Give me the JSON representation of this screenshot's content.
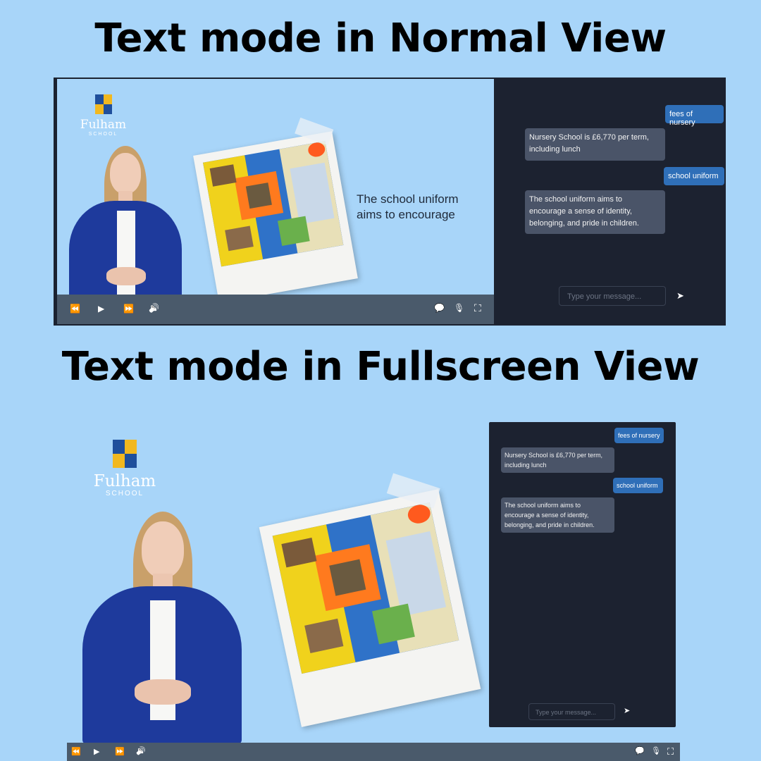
{
  "headings": {
    "normal": "Text mode in Normal View",
    "fullscreen": "Text mode in Fullscreen View"
  },
  "logo": {
    "name": "Fulham",
    "sub": "SCHOOL"
  },
  "slide": {
    "caption_line1": "The school uniform",
    "caption_line2": "aims to encourage"
  },
  "controls": {
    "rewind_icon": "⏪",
    "play_icon": "▶",
    "forward_icon": "⏩",
    "volume_icon": "🔊",
    "chat_icon": "💬",
    "mic_off_icon": "🎙",
    "fullscreen_icon": "⛶"
  },
  "chat": {
    "messages": [
      {
        "role": "user",
        "text": "fees of nursery"
      },
      {
        "role": "bot",
        "text": "Nursery School is £6,770 per term, including lunch"
      },
      {
        "role": "user",
        "text": "school uniform"
      },
      {
        "role": "bot",
        "text": "The school uniform aims to encourage a sense of identity, belonging, and pride in children."
      }
    ],
    "input_placeholder": "Type your message...",
    "send_icon": "➤"
  },
  "colors": {
    "background": "#a8d5f9",
    "chat_bg": "#1c2230",
    "user_bubble": "#2f6fb8",
    "bot_bubble": "#4a5468",
    "logo_blue": "#1f4f9c",
    "logo_yellow": "#f2b81f"
  }
}
